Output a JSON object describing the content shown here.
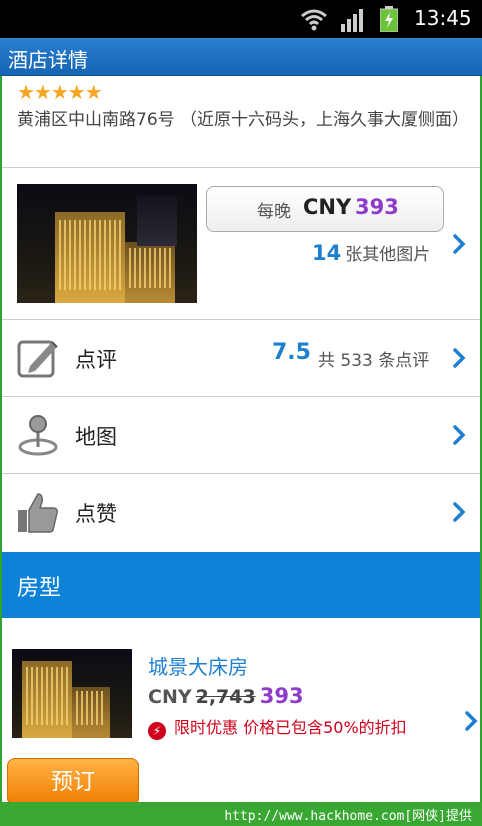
{
  "status_bar": {
    "time": "13:45"
  },
  "title_bar": {
    "title": "酒店详情"
  },
  "hotel": {
    "stars": "★★★★★",
    "address": "黄浦区中山南路76号 （近原十六码头，上海久事大厦侧面）",
    "price": {
      "per_night": "每晚",
      "currency": "CNY",
      "amount": "393"
    },
    "photos": {
      "count": "14",
      "label": "张其他图片"
    }
  },
  "rows": {
    "review": {
      "label": "点评",
      "score": "7.5",
      "count_text": "共 533 条点评"
    },
    "map": {
      "label": "地图"
    },
    "like": {
      "label": "点赞"
    }
  },
  "rooms_section": {
    "title": "房型"
  },
  "room": {
    "name": "城景大床房",
    "currency": "CNY",
    "old_price": "2,743",
    "new_price": "393",
    "promo": "限时优惠 价格已包含50%的折扣"
  },
  "book_button": {
    "label": "预订"
  },
  "watermark": {
    "text": "http://www.hackhome.com[网侠]提供"
  },
  "colors": {
    "accent": "#1f7fcf",
    "price": "#8e3bc9",
    "header": "#0d83d8",
    "button": "#f07d00",
    "promo": "#d0021b"
  },
  "icons": [
    "wifi-icon",
    "signal-icon",
    "battery-icon",
    "edit-icon",
    "map-pin-icon",
    "thumbs-up-icon",
    "chevron-right-icon",
    "bolt-icon"
  ]
}
